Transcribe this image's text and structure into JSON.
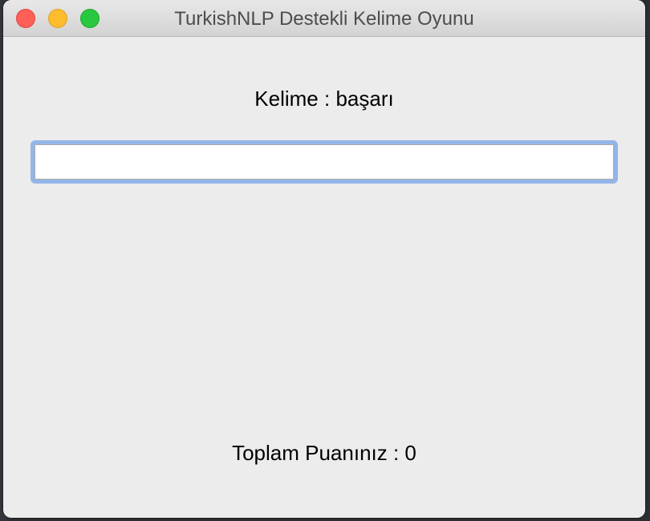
{
  "window": {
    "title": "TurkishNLP Destekli Kelime Oyunu"
  },
  "game": {
    "word_label": "Kelime : başarı",
    "input_value": "",
    "score_label": "Toplam Puanınız : 0"
  },
  "icons": {
    "close": "close-icon",
    "minimize": "minimize-icon",
    "zoom": "zoom-icon"
  },
  "colors": {
    "close": "#fe5f57",
    "minimize": "#febc2e",
    "zoom": "#28c840",
    "focus_ring": "#94b5e8",
    "window_bg": "#ececec"
  }
}
